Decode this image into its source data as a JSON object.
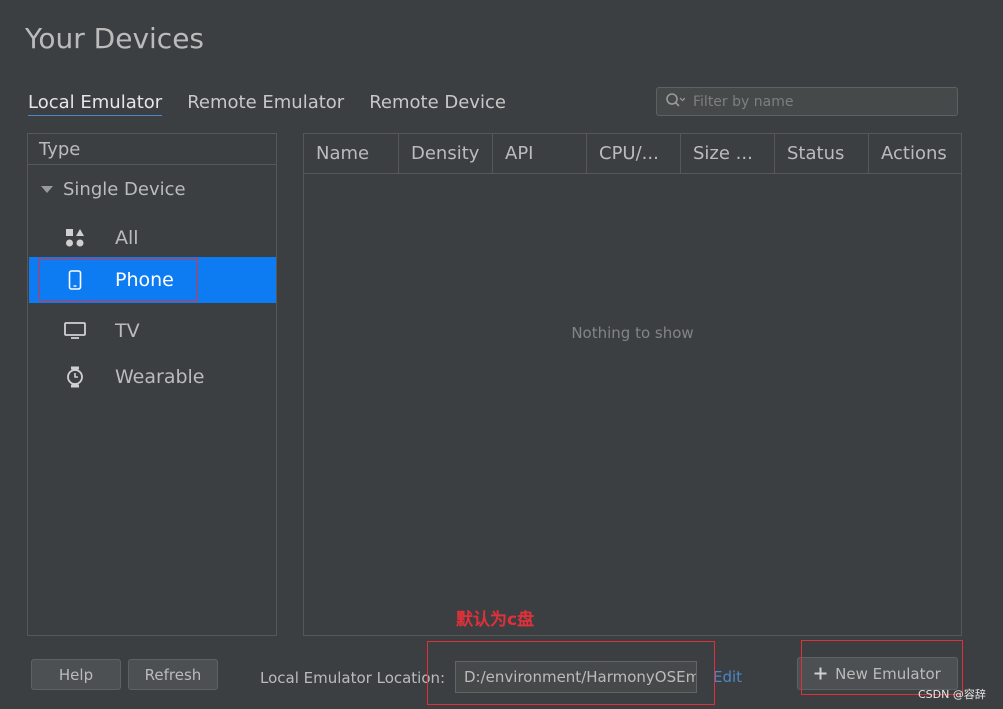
{
  "title": "Your Devices",
  "tabs": [
    {
      "label": "Local Emulator",
      "active": true
    },
    {
      "label": "Remote Emulator",
      "active": false
    },
    {
      "label": "Remote Device",
      "active": false
    }
  ],
  "search": {
    "placeholder": "Filter by name",
    "icon": "search-icon"
  },
  "type_panel": {
    "header": "Type",
    "group_label": "Single Device",
    "items": [
      {
        "label": "All",
        "icon": "grid-shapes-icon",
        "selected": false
      },
      {
        "label": "Phone",
        "icon": "phone-icon",
        "selected": true
      },
      {
        "label": "TV",
        "icon": "tv-icon",
        "selected": false
      },
      {
        "label": "Wearable",
        "icon": "watch-icon",
        "selected": false
      }
    ]
  },
  "table": {
    "columns": [
      "Name",
      "Density",
      "API",
      "CPU/...",
      "Size ...",
      "Status",
      "Actions"
    ],
    "empty_text": "Nothing to show"
  },
  "footer": {
    "help_label": "Help",
    "refresh_label": "Refresh",
    "location_label": "Local Emulator Location:",
    "location_value": "D:/environment/HarmonyOSEmulator",
    "edit_label": "Edit",
    "new_emulator_label": "New Emulator",
    "new_emulator_icon": "plus-icon"
  },
  "annotation": {
    "text": "默认为c盘",
    "color": "#e0303a"
  },
  "watermark_credit": "CSDN @容辞",
  "colors": {
    "background": "#3c3f41",
    "selection": "#0d7bf2",
    "link": "#4a88c7",
    "annotation": "#e0303a"
  }
}
